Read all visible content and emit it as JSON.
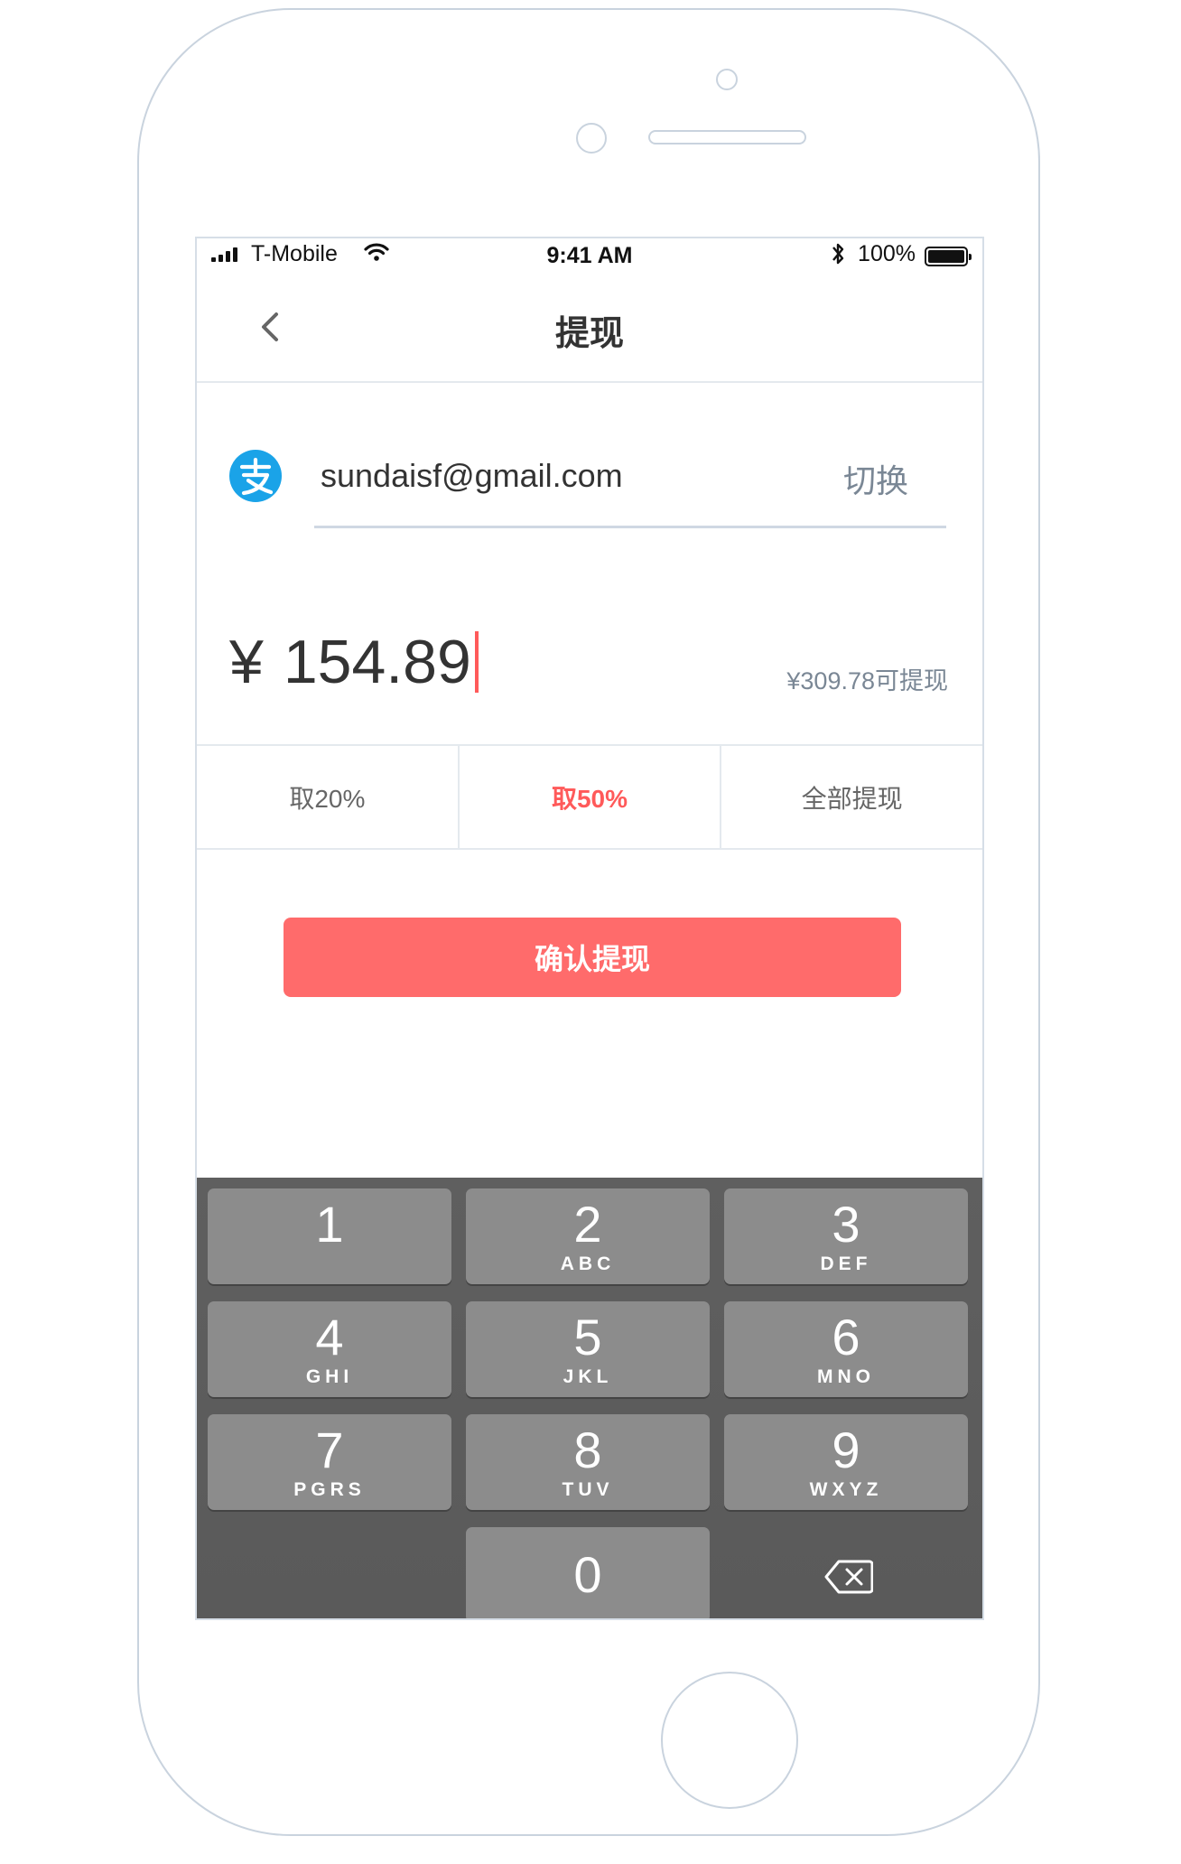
{
  "status_bar": {
    "carrier": "T-Mobile",
    "time": "9:41 AM",
    "battery": "100%"
  },
  "nav": {
    "title": "提现"
  },
  "account": {
    "email": "sundaisf@gmail.com",
    "switch_label": "切换"
  },
  "amount": {
    "currency": "¥",
    "value": "154.89",
    "available": "¥309.78可提现"
  },
  "options": [
    {
      "label": "取20%"
    },
    {
      "label": "取50%"
    },
    {
      "label": "全部提现"
    }
  ],
  "confirm_label": "确认提现",
  "keypad": {
    "keys": [
      {
        "num": "1",
        "letters": ""
      },
      {
        "num": "2",
        "letters": "ABC"
      },
      {
        "num": "3",
        "letters": "DEF"
      },
      {
        "num": "4",
        "letters": "GHI"
      },
      {
        "num": "5",
        "letters": "JKL"
      },
      {
        "num": "6",
        "letters": "MNO"
      },
      {
        "num": "7",
        "letters": "PGRS"
      },
      {
        "num": "8",
        "letters": "TUV"
      },
      {
        "num": "9",
        "letters": "WXYZ"
      },
      {
        "num": "0",
        "letters": ""
      }
    ]
  },
  "colors": {
    "accent": "#ff6b6b",
    "alipay": "#1aa3e8",
    "keypad_bg": "#5d5d5d",
    "key_bg": "#8c8c8c"
  },
  "icons": [
    "signal-icon",
    "wifi-icon",
    "bluetooth-icon",
    "battery-icon",
    "back-chevron-icon",
    "alipay-icon",
    "backspace-icon"
  ]
}
